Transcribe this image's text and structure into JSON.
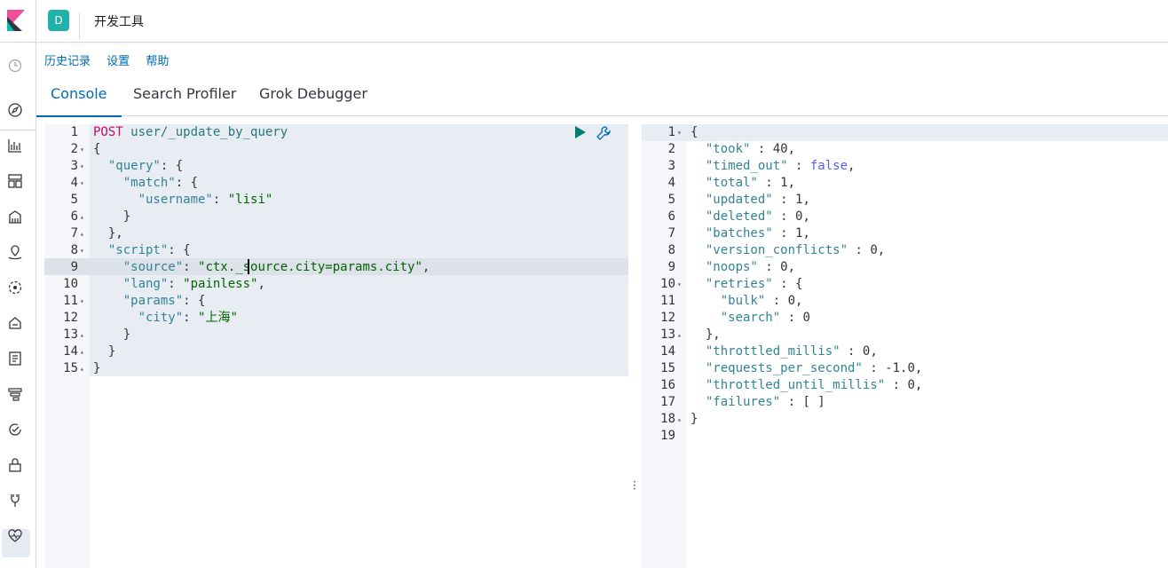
{
  "header": {
    "space_initial": "D",
    "title": "开发工具"
  },
  "menu": {
    "history": "历史记录",
    "settings": "设置",
    "help": "帮助"
  },
  "tabs": [
    {
      "label": "Console",
      "active": true
    },
    {
      "label": "Search Profiler",
      "active": false
    },
    {
      "label": "Grok Debugger",
      "active": false
    }
  ],
  "colors": {
    "accent": "#006bb4",
    "space_badge": "#20b2aa"
  },
  "icons": [
    "clock-icon",
    "compass-icon",
    "chart-icon",
    "dashboard-icon",
    "canvas-icon",
    "maps-icon",
    "ml-icon",
    "infra-icon",
    "logs-icon",
    "apm-icon",
    "uptime-icon",
    "security-icon",
    "dev-tools-icon",
    "monitoring-icon"
  ],
  "request": {
    "lines": [
      "POST user/_update_by_query",
      "{",
      "  \"query\": {",
      "    \"match\": {",
      "      \"username\": \"lisi\"",
      "    }",
      "  },",
      "  \"script\": {",
      "    \"source\": \"ctx._source.city=params.city\",",
      "    \"lang\": \"painless\",",
      "    \"params\": {",
      "      \"city\": \"上海\"",
      "    }",
      "  }",
      "}"
    ]
  },
  "response": {
    "lines": [
      "{",
      "  \"took\" : 40,",
      "  \"timed_out\" : false,",
      "  \"total\" : 1,",
      "  \"updated\" : 1,",
      "  \"deleted\" : 0,",
      "  \"batches\" : 1,",
      "  \"version_conflicts\" : 0,",
      "  \"noops\" : 0,",
      "  \"retries\" : {",
      "    \"bulk\" : 0,",
      "    \"search\" : 0",
      "  },",
      "  \"throttled_millis\" : 0,",
      "  \"requests_per_second\" : -1.0,",
      "  \"throttled_until_millis\" : 0,",
      "  \"failures\" : [ ]",
      "}",
      ""
    ]
  }
}
